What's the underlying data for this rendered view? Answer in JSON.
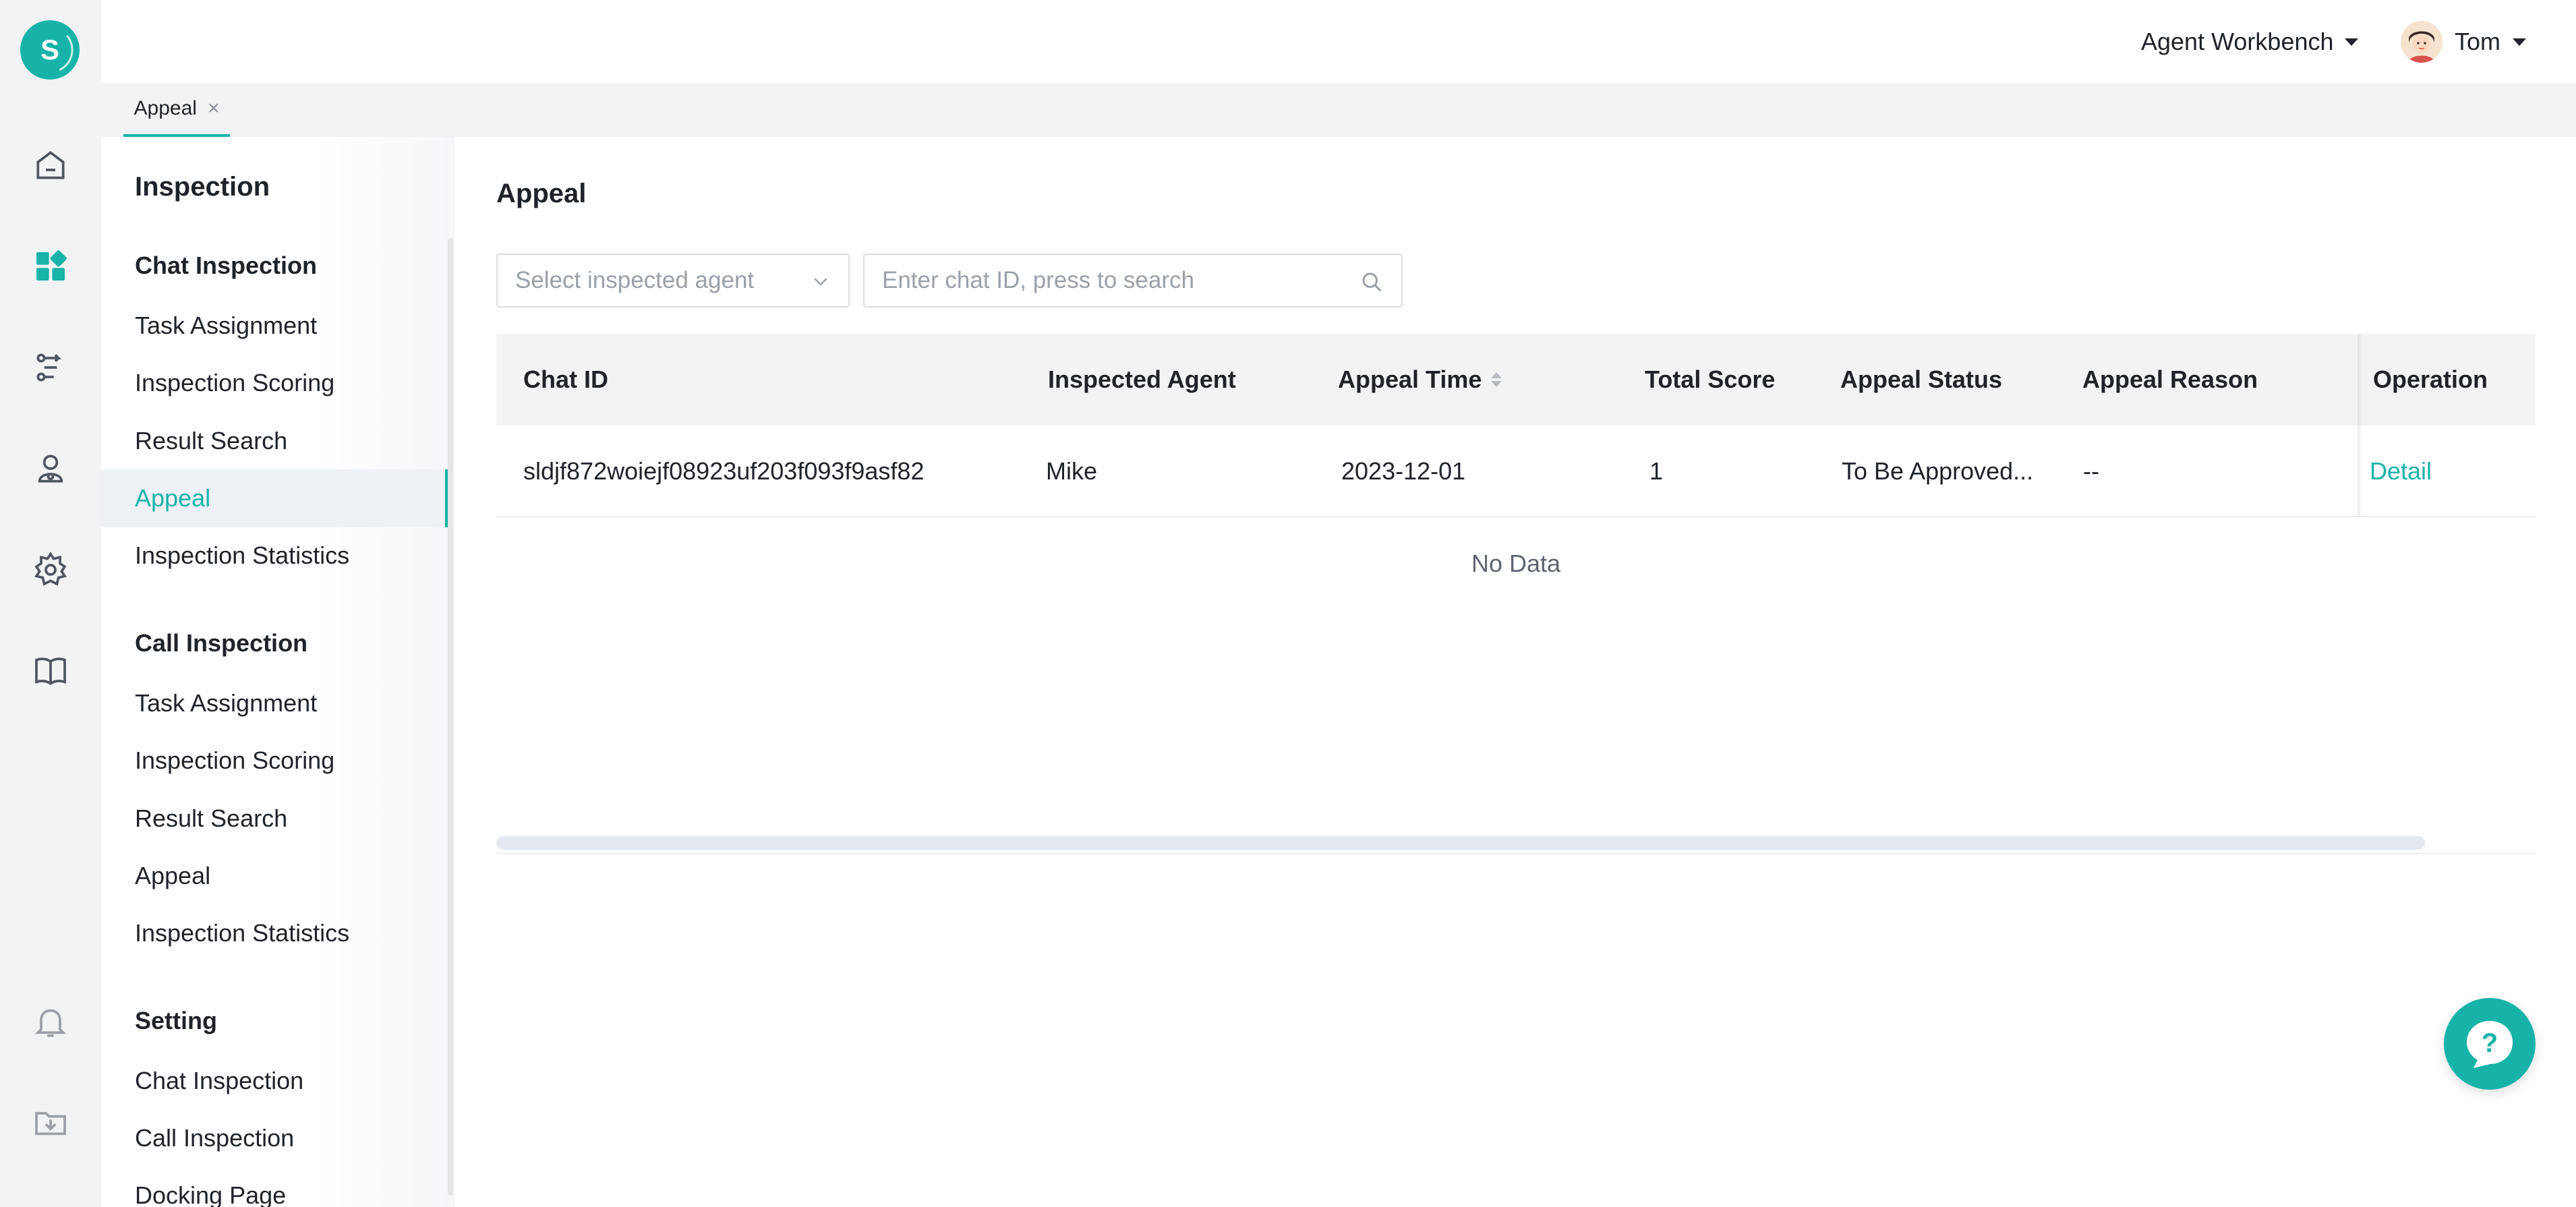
{
  "app": {
    "logo_letter": "S",
    "accent_color": "#17b3a8"
  },
  "rail": {
    "icons": [
      "home-icon",
      "dashboard-icon",
      "route-icon",
      "agent-icon",
      "settings-icon",
      "book-icon",
      "bell-icon",
      "download-folder-icon"
    ]
  },
  "header": {
    "workbench_label": "Agent Workbench",
    "user_name": "Tom"
  },
  "tabs": [
    {
      "label": "Appeal",
      "close": "×"
    }
  ],
  "sidebar": {
    "title": "Inspection",
    "groups": [
      {
        "label": "Chat Inspection",
        "items": [
          "Task Assignment",
          "Inspection Scoring",
          "Result Search",
          "Appeal",
          "Inspection Statistics"
        ]
      },
      {
        "label": "Call Inspection",
        "items": [
          "Task Assignment",
          "Inspection Scoring",
          "Result Search",
          "Appeal",
          "Inspection Statistics"
        ]
      },
      {
        "label": "Setting",
        "items": [
          "Chat Inspection",
          "Call Inspection",
          "Docking Page"
        ]
      }
    ],
    "active": "Chat Inspection / Appeal"
  },
  "main": {
    "title": "Appeal",
    "agent_select_placeholder": "Select inspected agent",
    "search_placeholder": "Enter chat ID, press to search",
    "table": {
      "columns": [
        "Chat ID",
        "Inspected Agent",
        "Appeal Time",
        "Total Score",
        "Appeal Status",
        "Appeal Reason",
        "Operation"
      ],
      "rows": [
        {
          "chat_id": "sldjf872woiejf08923uf203f093f9asf82",
          "agent": "Mike",
          "appeal_time": "2023-12-01",
          "total_score": "1",
          "status": "To Be Approved...",
          "reason": "--",
          "operation": "Detail"
        }
      ],
      "empty_text": "No Data"
    }
  },
  "help": {
    "label": "?"
  }
}
